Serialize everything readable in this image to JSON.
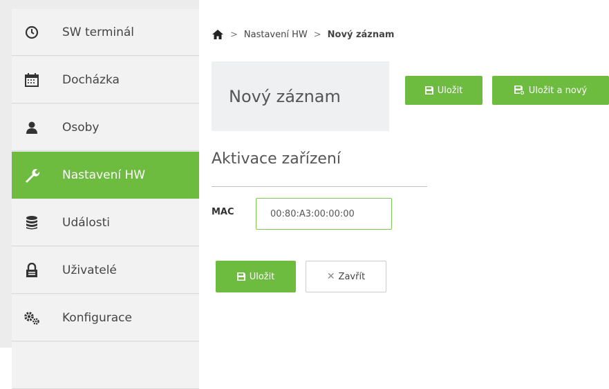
{
  "sidebar": {
    "items": [
      {
        "label": "SW terminál",
        "icon": "clock-icon"
      },
      {
        "label": "Docházka",
        "icon": "calendar-icon"
      },
      {
        "label": "Osoby",
        "icon": "user-icon"
      },
      {
        "label": "Nastavení HW",
        "icon": "wrench-icon",
        "active": true
      },
      {
        "label": "Události",
        "icon": "database-icon"
      },
      {
        "label": "Uživatelé",
        "icon": "lock-icon"
      },
      {
        "label": "Konfigurace",
        "icon": "cogs-icon"
      }
    ]
  },
  "breadcrumb": {
    "home_icon": "home-icon",
    "item1": "Nastavení HW",
    "current": "Nový záznam"
  },
  "header": {
    "title": "Nový záznam",
    "save_label": "Uložit",
    "save_new_label": "Uložit a nový"
  },
  "form": {
    "section_title": "Aktivace zařízení",
    "mac_label": "MAC",
    "mac_value": "00:80:A3:00:00:00"
  },
  "footer": {
    "save_label": "Uložit",
    "close_label": "Zavřít"
  },
  "colors": {
    "accent": "#6dbb3f",
    "sidebar_bg": "#f2f2f2",
    "title_box_bg": "#eef0f2"
  }
}
